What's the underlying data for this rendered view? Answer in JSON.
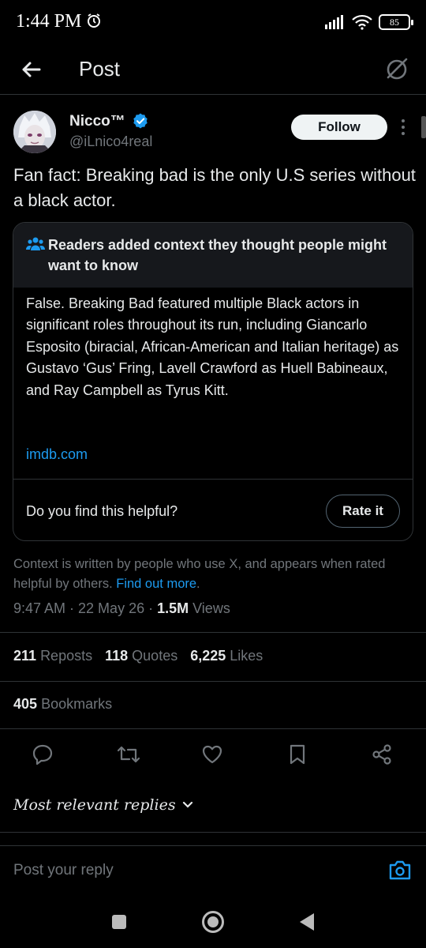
{
  "status_bar": {
    "time": "1:44 PM",
    "battery": "85"
  },
  "top_bar": {
    "title": "Post"
  },
  "post": {
    "author_name": "Nicco™",
    "author_handle": "@iLnico4real",
    "follow_label": "Follow",
    "text": "Fan fact: Breaking bad is the only U.S series without a black actor.",
    "timestamp": "9:47 AM · 22 May 26 · ",
    "views_count": "1.5M",
    "views_label": " Views"
  },
  "community_note": {
    "title": "Readers added context they thought people might want to know",
    "body": "False. Breaking Bad featured multiple Black actors in significant roles throughout its run, including Giancarlo Esposito (biracial, African-American and Italian heritage) as Gustavo ‘Gus’ Fring, Lavell Crawford as Huell Babineaux, and Ray Campbell as Tyrus Kitt.",
    "link": "imdb.com",
    "helpful_question": "Do you find this helpful?",
    "rate_label": "Rate it"
  },
  "context_footer": {
    "text": "Context is written by people who use X, and appears when rated helpful by others. ",
    "link": "Find out more",
    "suffix": "."
  },
  "stats": {
    "reposts_count": "211",
    "reposts_label": "Reposts",
    "quotes_count": "118",
    "quotes_label": "Quotes",
    "likes_count": "6,225",
    "likes_label": "Likes",
    "bookmarks_count": "405",
    "bookmarks_label": "Bookmarks"
  },
  "actions": [
    "reply-icon",
    "repost-icon",
    "like-icon",
    "bookmark-icon",
    "share-icon"
  ],
  "replies": {
    "sort_label": "Most relevant replies"
  },
  "reply_bar": {
    "placeholder": "Post your reply"
  },
  "colors": {
    "background": "#000000",
    "text": "#e7e9ea",
    "muted": "#71767b",
    "accent": "#1d9bf0",
    "border": "#2f3336"
  }
}
